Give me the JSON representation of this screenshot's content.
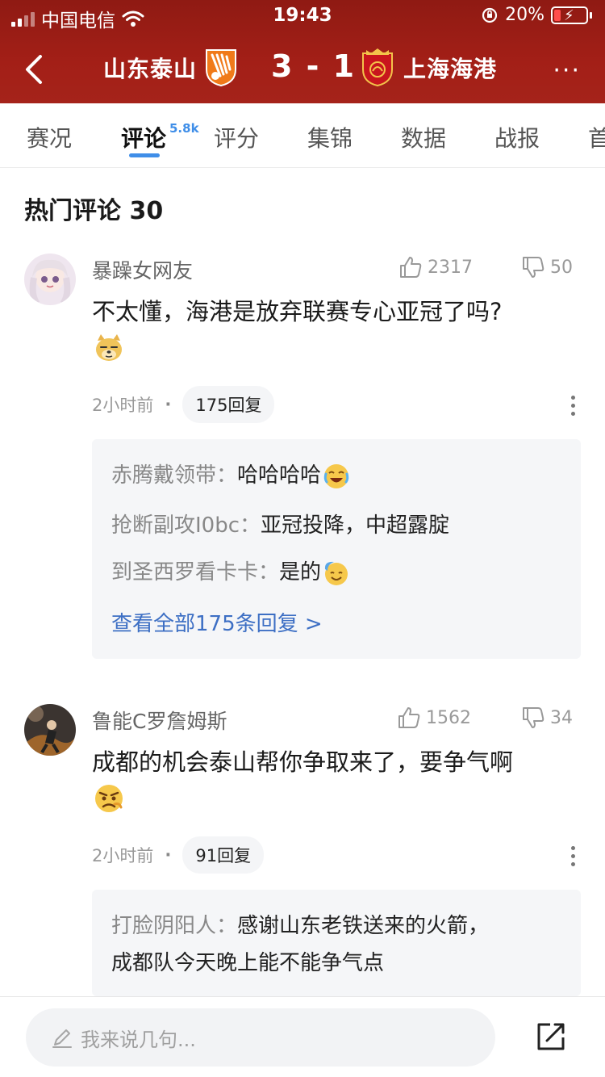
{
  "status_bar": {
    "carrier": "中国电信",
    "time": "19:43",
    "battery": "20%"
  },
  "match": {
    "home_team": "山东泰山",
    "score": "3 - 1",
    "away_team": "上海海港",
    "more": "···"
  },
  "tabs": [
    {
      "label": "赛况"
    },
    {
      "label": "评论",
      "count": "5.8k",
      "active": true
    },
    {
      "label": "评分"
    },
    {
      "label": "集锦"
    },
    {
      "label": "数据"
    },
    {
      "label": "战报"
    },
    {
      "label": "首"
    }
  ],
  "section": {
    "title": "热门评论 30"
  },
  "comments": [
    {
      "user": "暴躁女网友",
      "likes": "2317",
      "dislikes": "50",
      "text": "不太懂，海港是放弃联赛专心亚冠了吗?",
      "time": "2小时前",
      "replies_label": "175回复",
      "reply_preview": [
        {
          "name": "赤腾戴领带：",
          "text": "哈哈哈哈"
        },
        {
          "name": "抢断副攻I0bc：",
          "text": "亚冠投降，中超露腚"
        },
        {
          "name": "到圣西罗看卡卡：",
          "text": "是的"
        }
      ],
      "view_all": "查看全部175条回复 >"
    },
    {
      "user": "鲁能C罗詹姆斯",
      "likes": "1562",
      "dislikes": "34",
      "text": "成都的机会泰山帮你争取来了，要争气啊",
      "time": "2小时前",
      "replies_label": "91回复",
      "reply_preview": [
        {
          "name": "打脸阴阳人：",
          "text": "感谢山东老铁送来的火箭，",
          "text2": "成都队今天晚上能不能争气点"
        }
      ]
    }
  ],
  "input": {
    "placeholder": "我来说几句..."
  },
  "colors": {
    "header_red": "#a31f17",
    "accent_blue": "#3f8ee8",
    "link_blue": "#3d6fc4"
  }
}
